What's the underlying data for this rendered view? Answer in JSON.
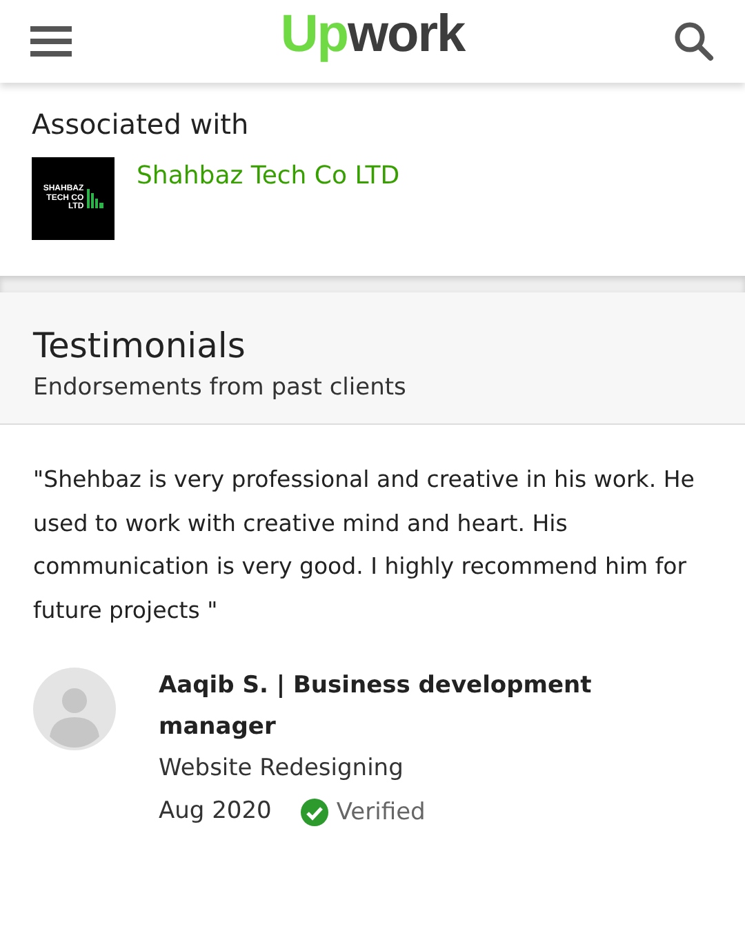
{
  "header": {
    "logo": {
      "accent": "Up",
      "rest": "work"
    }
  },
  "associated": {
    "heading": "Associated with",
    "company": {
      "name": "Shahbaz Tech Co LTD",
      "logo_lines": [
        "SHAHBAZ",
        "TECH CO",
        "LTD"
      ]
    }
  },
  "testimonials": {
    "title": "Testimonials",
    "subtitle": "Endorsements from past clients",
    "items": [
      {
        "quote": "\"Shehbaz is very professional and creative in his work. He used to work with creative mind and heart. His communication is very good. I highly recommend him for future projects \"",
        "author": "Aaqib S. | Business development manager",
        "project": "Website Redesigning",
        "date": "Aug 2020",
        "verified": true,
        "verified_label": "Verified"
      }
    ]
  }
}
